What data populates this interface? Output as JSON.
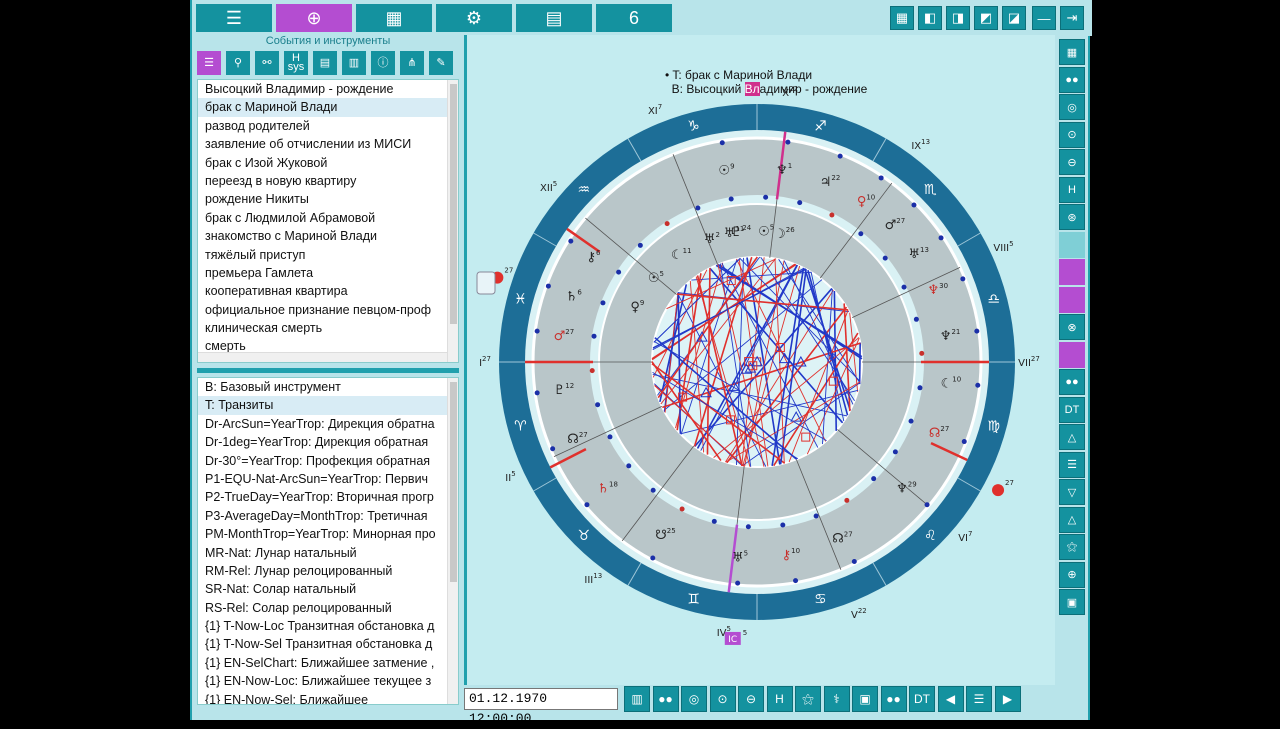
{
  "toolbar": {
    "buttons": [
      {
        "icon": "menu-icon",
        "glyph": "☰"
      },
      {
        "icon": "crosshair-icon",
        "glyph": "⊕"
      },
      {
        "icon": "grid-icon",
        "glyph": "▦"
      },
      {
        "icon": "gear-icon",
        "glyph": "⚙"
      },
      {
        "icon": "calculator-icon",
        "glyph": "▤"
      },
      {
        "icon": "logo-icon",
        "glyph": "6"
      }
    ],
    "right_buttons": [
      "▦",
      "◧",
      "◨",
      "◩",
      "◪",
      "—",
      "⇥"
    ]
  },
  "left_panel": {
    "title": "События и инструменты",
    "tools": [
      {
        "icon": "list-icon",
        "label": "☰"
      },
      {
        "icon": "transit-tool-icon",
        "label": "⚲"
      },
      {
        "icon": "aspect-tool-icon",
        "label": "⚯"
      },
      {
        "icon": "house-system-icon",
        "label": "H\nsys"
      },
      {
        "icon": "notes-icon",
        "label": "▤"
      },
      {
        "icon": "table-icon",
        "label": "▥"
      },
      {
        "icon": "info-icon",
        "label": "ⓘ"
      },
      {
        "icon": "tree-icon",
        "label": "⋔"
      },
      {
        "icon": "edit-icon",
        "label": "✎"
      }
    ],
    "events": [
      "Высоцкий Владимир - рождение",
      "брак с Мариной Влади",
      "развод родителей",
      "заявление об отчислении из МИСИ",
      "брак с Изой Жуковой",
      "переезд в новую квартиру",
      "рождение Никиты",
      "брак с Людмилой Абрамовой",
      "знакомство с Мариной Влади",
      "тяжёлый приступ",
      "премьера Гамлета",
      "кооперативная квартира",
      "официальное признание певцом-проф",
      "клиническая смерть",
      "смерть"
    ],
    "selected_event": 1,
    "instruments": [
      "B: Базовый инструмент",
      "T: Транзиты",
      "Dr-ArcSun=YearTrop: Дирекция обратна",
      "Dr-1deg=YearTrop: Дирекция обратная",
      "Dr-30°=YearTrop: Профекция обратная",
      "P1-EQU-Nat-ArcSun=YearTrop: Первич",
      "P2-TrueDay=YearTrop: Вторичная прогр",
      "P3-AverageDay=MonthTrop: Третичная",
      "PM-MonthTrop=YearTrop: Минорная про",
      "MR-Nat: Лунар натальный",
      "RM-Rel: Лунар релоцированный",
      "SR-Nat: Солар натальный",
      "RS-Rel: Солар релоцированный",
      "{1} T-Now-Loc Транзитная обстановка д",
      "{1} T-Now-Sel Транзитная обстановка д",
      "{1} EN-SelChart: Ближайшее затмение ,",
      "{1} EN-Now-Loc: Ближайшее текущее з",
      "{1} EN-Now-Sel: Ближайшее"
    ],
    "selected_instrument": 1
  },
  "chart": {
    "header_line1": "• T: брак с Мариной Влади",
    "header_line2_pre": "B: Высоцкий ",
    "header_line2_hl": "Вл",
    "header_line2_post": "адимир - рождение",
    "zodiac": [
      "♈",
      "♉",
      "♊",
      "♋",
      "♌",
      "♍",
      "♎",
      "♏",
      "♐",
      "♑",
      "♒",
      "♓"
    ],
    "houses": [
      {
        "label": "I",
        "sup": "27"
      },
      {
        "label": "II",
        "sup": "5"
      },
      {
        "label": "III",
        "sup": "13"
      },
      {
        "label": "IV",
        "sup": "5"
      },
      {
        "label": "V",
        "sup": "22"
      },
      {
        "label": "VI",
        "sup": "7"
      },
      {
        "label": "VII",
        "sup": "27"
      },
      {
        "label": "VIII",
        "sup": "5"
      },
      {
        "label": "IX",
        "sup": "13"
      },
      {
        "label": "X",
        "sup": "22"
      },
      {
        "label": "XI",
        "sup": "7"
      },
      {
        "label": "XII",
        "sup": "5"
      }
    ],
    "angles": {
      "asc_sup": "27",
      "mc_sup": "5",
      "ic_label": "IC",
      "ic_sup": "5",
      "dc_sup": "27"
    },
    "outer_planets": [
      {
        "glyph": "☉",
        "deg": "9"
      },
      {
        "glyph": "♆",
        "deg": "1"
      },
      {
        "glyph": "♃",
        "deg": "22"
      },
      {
        "glyph": "♀",
        "deg": "10"
      },
      {
        "glyph": "♂",
        "deg": "27"
      },
      {
        "glyph": "♅",
        "deg": "13"
      },
      {
        "glyph": "♆",
        "deg": "30"
      },
      {
        "glyph": "♆",
        "deg": "21"
      },
      {
        "glyph": "☾",
        "deg": "10"
      },
      {
        "glyph": "☊",
        "deg": "27"
      },
      {
        "glyph": "♆",
        "deg": "29"
      },
      {
        "glyph": "☊",
        "deg": "27"
      },
      {
        "glyph": "⚷",
        "deg": "10"
      },
      {
        "glyph": "♅",
        "deg": "5"
      },
      {
        "glyph": "☋",
        "deg": "25"
      },
      {
        "glyph": "♄",
        "deg": "18"
      },
      {
        "glyph": "☊",
        "deg": "27"
      },
      {
        "glyph": "♇",
        "deg": "12"
      },
      {
        "glyph": "♂",
        "deg": "27"
      },
      {
        "glyph": "♄",
        "deg": "6"
      },
      {
        "glyph": "⚷",
        "deg": "6"
      }
    ],
    "inner_planets": [
      {
        "glyph": "☾",
        "deg": "11"
      },
      {
        "glyph": "♅",
        "deg": "2"
      },
      {
        "glyph": "♇",
        "deg": "24"
      },
      {
        "glyph": "☉",
        "deg": "5"
      },
      {
        "glyph": "☽",
        "deg": "26"
      },
      {
        "glyph": "♅",
        "deg": "11"
      },
      {
        "glyph": "☉",
        "deg": "5"
      },
      {
        "glyph": "♀",
        "deg": "9"
      }
    ]
  },
  "bottom": {
    "datetime": "01.12.1970 12:00:00",
    "buttons": [
      "▥",
      "●●",
      "◎",
      "⊙",
      "⊖",
      "H",
      "⚝",
      "⚕",
      "▣",
      "●●",
      "DT",
      "◀",
      "☰",
      "▶"
    ]
  },
  "right_tools": [
    "▦",
    "●●",
    "◎",
    "⊙",
    "⊖",
    "H",
    "⊛",
    "",
    "",
    "",
    "⊗",
    "",
    "●●",
    "DT",
    "△",
    "☰",
    "▽",
    "△",
    "⚝",
    "⊕",
    "▣"
  ],
  "colors": {
    "accent": "#14929f",
    "active": "#b44dd1",
    "zodiac_ring": "#1d6e97",
    "house_ring": "#b9c6c9",
    "aspect_red": "#e0302c",
    "aspect_blue": "#2038c8"
  }
}
